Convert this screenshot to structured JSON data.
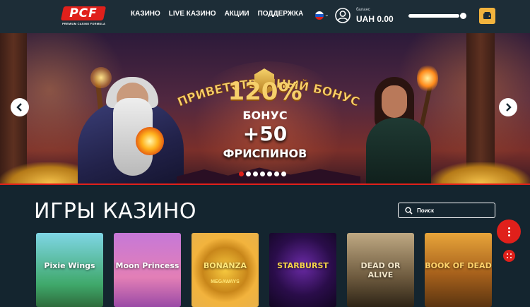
{
  "header": {
    "logo_text": "PCF",
    "logo_sub": "PREMIUM CASINO FORMULA",
    "nav": [
      {
        "label": "КАЗИНО"
      },
      {
        "label": "LIVE КАЗИНО"
      },
      {
        "label": "АКЦИИ"
      },
      {
        "label": "ПОДДЕРЖКА"
      }
    ],
    "language_flag": "ru-flag-icon",
    "balance_label": "баланс",
    "balance_value": "UAH 0.00",
    "icons": {
      "user": "user-icon",
      "wallet": "wallet-icon",
      "chevron": "chevron-down-icon"
    }
  },
  "banner": {
    "promo_title": "ПРИВЕТСТВЕННЫЙ БОНУС",
    "promo_percent": "120%",
    "promo_bonus": "БОНУС",
    "promo_free": "+50",
    "promo_spins": "ФРИСПИНОВ",
    "slide_count": 7,
    "active_slide": 1,
    "colors": {
      "accent": "#e0201b",
      "gold": "#f6d06b"
    }
  },
  "games": {
    "title": "ИГРЫ КАЗИНО",
    "search_placeholder": "Поиск",
    "tiles": [
      {
        "name": "Pixie Wings",
        "sub": "",
        "bg": "linear-gradient(180deg,#7fd6e6,#3fa86a 70%,#2e6b3c)",
        "color": "#ffffff"
      },
      {
        "name": "Moon Princess",
        "sub": "",
        "bg": "linear-gradient(180deg,#c678d8,#e37fb6 60%,#9a4aa6)",
        "color": "#ffffff"
      },
      {
        "name": "BONANZA",
        "sub": "MEGAWAYS",
        "bg": "radial-gradient(circle at 50% 50%,#f7c93f 0%,#c8861a 45%,#f2b33d 65%,#e9b24a 100%)",
        "color": "#ffe77a"
      },
      {
        "name": "STARBURST",
        "sub": "",
        "bg": "radial-gradient(circle at 50% 45%,#6a2aa6 0%,#2a0d4a 55%,#120622 100%)",
        "color": "#f7d54a"
      },
      {
        "name": "DEAD OR ALIVE",
        "sub": "",
        "bg": "linear-gradient(180deg,#bfa983,#6d5a3e 60%,#2e2416)",
        "color": "#f0e4c8"
      },
      {
        "name": "BOOK OF DEAD",
        "sub": "",
        "bg": "linear-gradient(180deg,#e8a53a,#a7611c 55%,#5a3410)",
        "color": "#ffd36b"
      }
    ]
  }
}
